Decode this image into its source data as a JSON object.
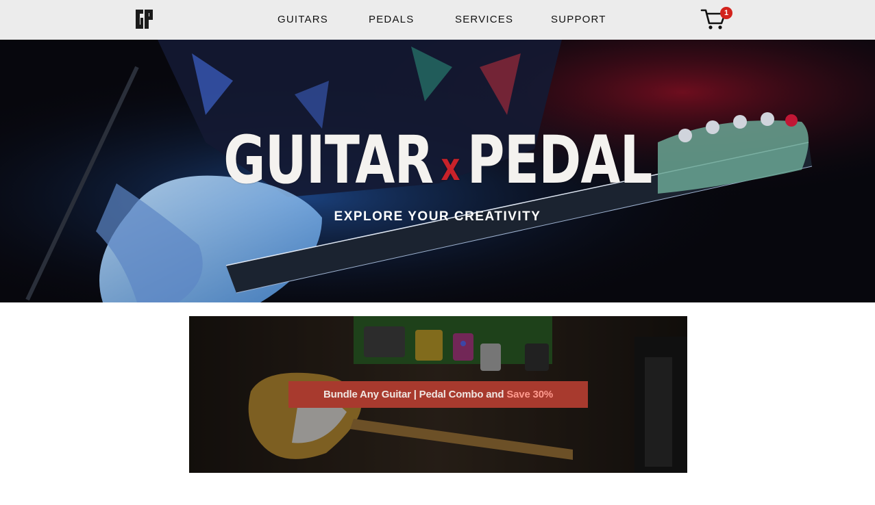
{
  "nav": {
    "logo_text": "GP",
    "links": [
      {
        "label": "GUITARS"
      },
      {
        "label": "PEDALS"
      },
      {
        "label": "SERVICES"
      },
      {
        "label": "SUPPORT"
      }
    ],
    "cart_count": "1"
  },
  "hero": {
    "title_left": "GUITAR",
    "title_x": "x",
    "title_right": "PEDAL",
    "subtitle": "EXPLORE YOUR CREATIVITY"
  },
  "promo": {
    "text": "Bundle Any Guitar | Pedal Combo and",
    "highlight": "Save 30%"
  },
  "colors": {
    "nav_bg": "#ececec",
    "accent_red": "#c8222a",
    "banner_bg": "#a83a2e",
    "badge_red": "#d3231c"
  }
}
